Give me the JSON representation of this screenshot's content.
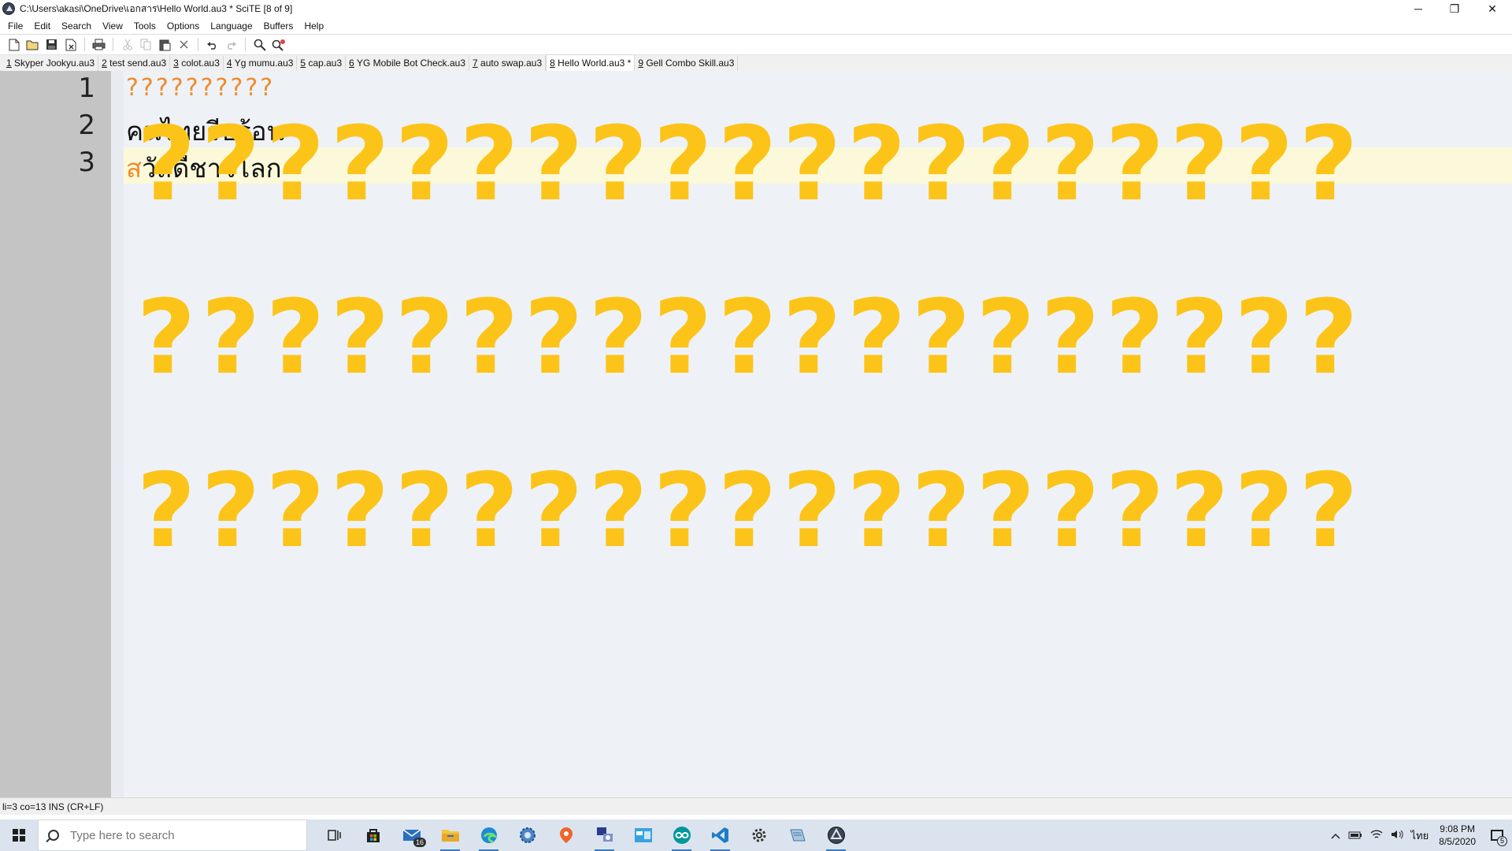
{
  "window": {
    "title": "C:\\Users\\akasi\\OneDrive\\เอกสาร\\Hello World.au3 * SciTE [8 of 9]",
    "minimize": "─",
    "restore": "❐",
    "close": "✕"
  },
  "menu": [
    "File",
    "Edit",
    "Search",
    "View",
    "Tools",
    "Options",
    "Language",
    "Buffers",
    "Help"
  ],
  "tabs": [
    {
      "num": "1",
      "label": " Skyper Jookyu.au3"
    },
    {
      "num": "2",
      "label": " test send.au3"
    },
    {
      "num": "3",
      "label": " colot.au3"
    },
    {
      "num": "4",
      "label": " Yg mumu.au3"
    },
    {
      "num": "5",
      "label": " cap.au3"
    },
    {
      "num": "6",
      "label": " YG Mobile Bot Check.au3"
    },
    {
      "num": "7",
      "label": " auto swap.au3"
    },
    {
      "num": "8",
      "label": " Hello World.au3 *"
    },
    {
      "num": "9",
      "label": " Gell Combo Skill.au3"
    }
  ],
  "editor": {
    "line_numbers": [
      "1",
      "2",
      "3"
    ],
    "line1": "??????????",
    "line2": "คนไทยรีบร้อน",
    "line3_first": "ส",
    "line3_rest": "วัสดีชาวโลก",
    "overlay_row": "???????????????????"
  },
  "status": "li=3 co=13 INS (CR+LF)",
  "taskbar": {
    "search_placeholder": "Type here to search",
    "mail_badge": "16",
    "clock_time": "9:08 PM",
    "clock_date": "8/5/2020",
    "lang": "ไทย",
    "notif_count": "5"
  }
}
